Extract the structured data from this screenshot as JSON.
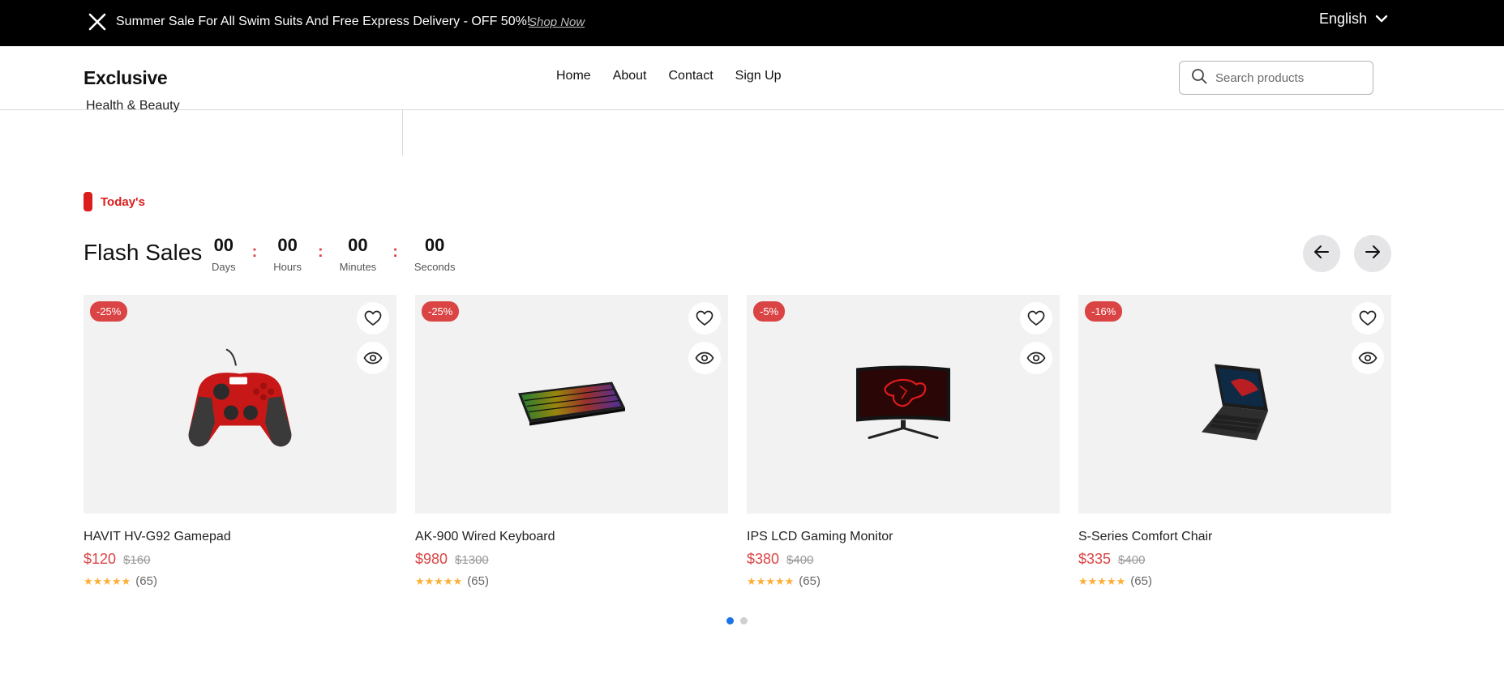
{
  "announcement": {
    "text": "Summer Sale For All Swim Suits And Free Express Delivery - OFF 50%!",
    "link": "Shop Now",
    "language": "English"
  },
  "header": {
    "logo": "Exclusive",
    "nav": [
      "Home",
      "About",
      "Contact",
      "Sign Up"
    ],
    "search_placeholder": "Search products"
  },
  "sidebar": {
    "partial_item": "Health & Beauty"
  },
  "section": {
    "tag": "Today's",
    "title": "Flash Sales",
    "timer": [
      {
        "value": "00",
        "label": "Days"
      },
      {
        "value": "00",
        "label": "Hours"
      },
      {
        "value": "00",
        "label": "Minutes"
      },
      {
        "value": "00",
        "label": "Seconds"
      }
    ],
    "separator": ":"
  },
  "products": [
    {
      "discount": "-25%",
      "name": "HAVIT HV-G92 Gamepad",
      "price": "$120",
      "old_price": "$160",
      "stars": "★★★★★",
      "reviews": "(65)",
      "icon": "gamepad-image"
    },
    {
      "discount": "-25%",
      "name": "AK-900 Wired Keyboard",
      "price": "$980",
      "old_price": "$1300",
      "stars": "★★★★★",
      "reviews": "(65)",
      "icon": "keyboard-image"
    },
    {
      "discount": "-5%",
      "name": "IPS LCD Gaming Monitor",
      "price": "$380",
      "old_price": "$400",
      "stars": "★★★★★",
      "reviews": "(65)",
      "icon": "monitor-image"
    },
    {
      "discount": "-16%",
      "name": "S-Series Comfort Chair",
      "price": "$335",
      "old_price": "$400",
      "stars": "★★★★★",
      "reviews": "(65)",
      "icon": "laptop-image"
    }
  ],
  "carousel": {
    "pages": 2,
    "active": 1
  },
  "colors": {
    "accent": "#db4444",
    "star": "#ffad33",
    "dot_active": "#1a73e8"
  }
}
